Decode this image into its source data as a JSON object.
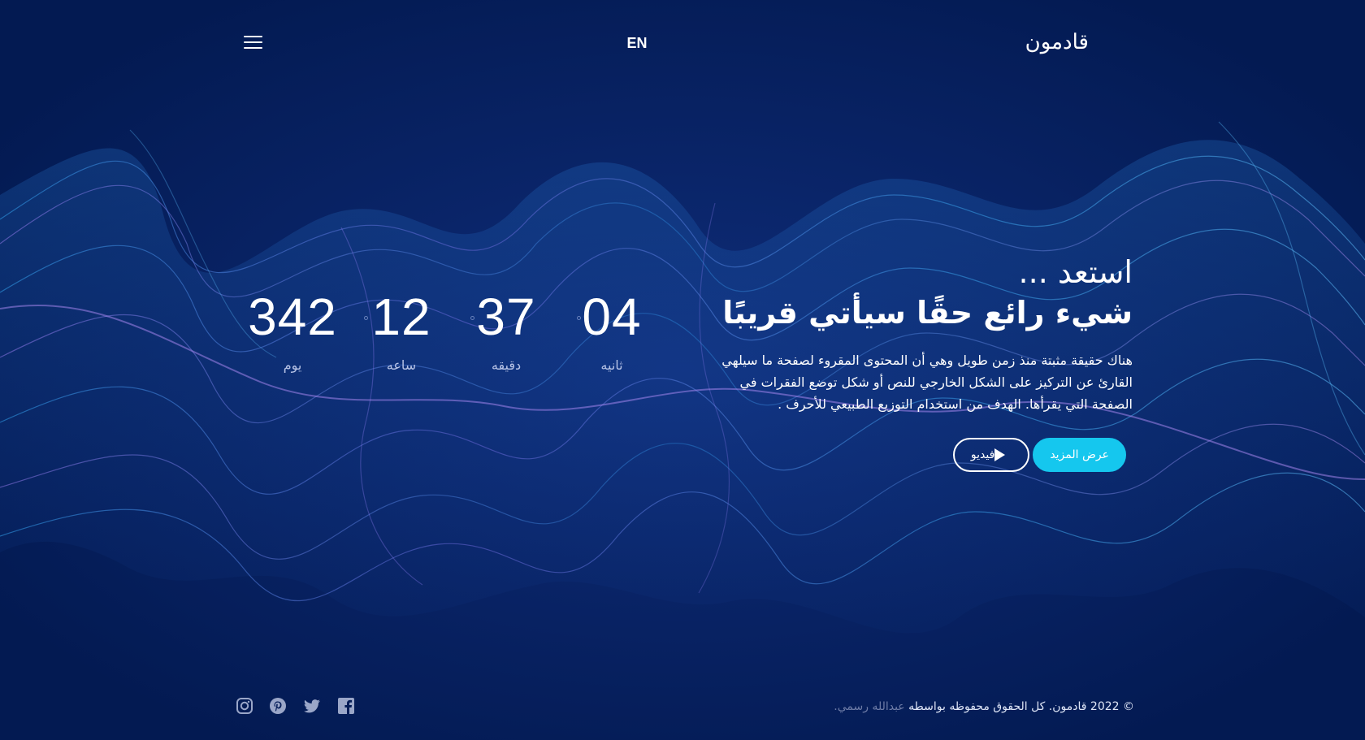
{
  "header": {
    "menu_icon": "hamburger-menu-icon",
    "language": "EN",
    "logo_text": "قادمون"
  },
  "countdown": {
    "days": {
      "value": "342",
      "label": "يوم"
    },
    "hours": {
      "value": "12",
      "label": "ساعه"
    },
    "minutes": {
      "value": "37",
      "label": "دقيقه"
    },
    "seconds": {
      "value": "04",
      "label": "ثانيه"
    }
  },
  "hero": {
    "title": "استعد ...",
    "subtitle": "شيء رائع حقًا سيأتي قريبًا",
    "description": "هناك حقيقة مثبتة منذ زمن طويل وهي أن المحتوى المقروء لصفحة ما سيلهي القارئ عن التركيز على الشكل الخارجي للنص أو شكل توضع الفقرات في الصفحة التي يقرأها. الهدف من استخدام التوزيع الطبيعي للأحرف .",
    "more_button": "عرض المزيد",
    "video_button": "فيديو"
  },
  "footer": {
    "copyright_text": "© 2022 قادمون. كل الحقوق محفوظه بواسطه",
    "author": "عبدالله رسمي.",
    "social": [
      "instagram-icon",
      "pinterest-icon",
      "twitter-icon",
      "facebook-icon"
    ]
  },
  "colors": {
    "background": "#041c57",
    "accent": "#15c7ee",
    "wave_blue": "#2a8fe0",
    "wave_purple": "#8b6ee8"
  }
}
